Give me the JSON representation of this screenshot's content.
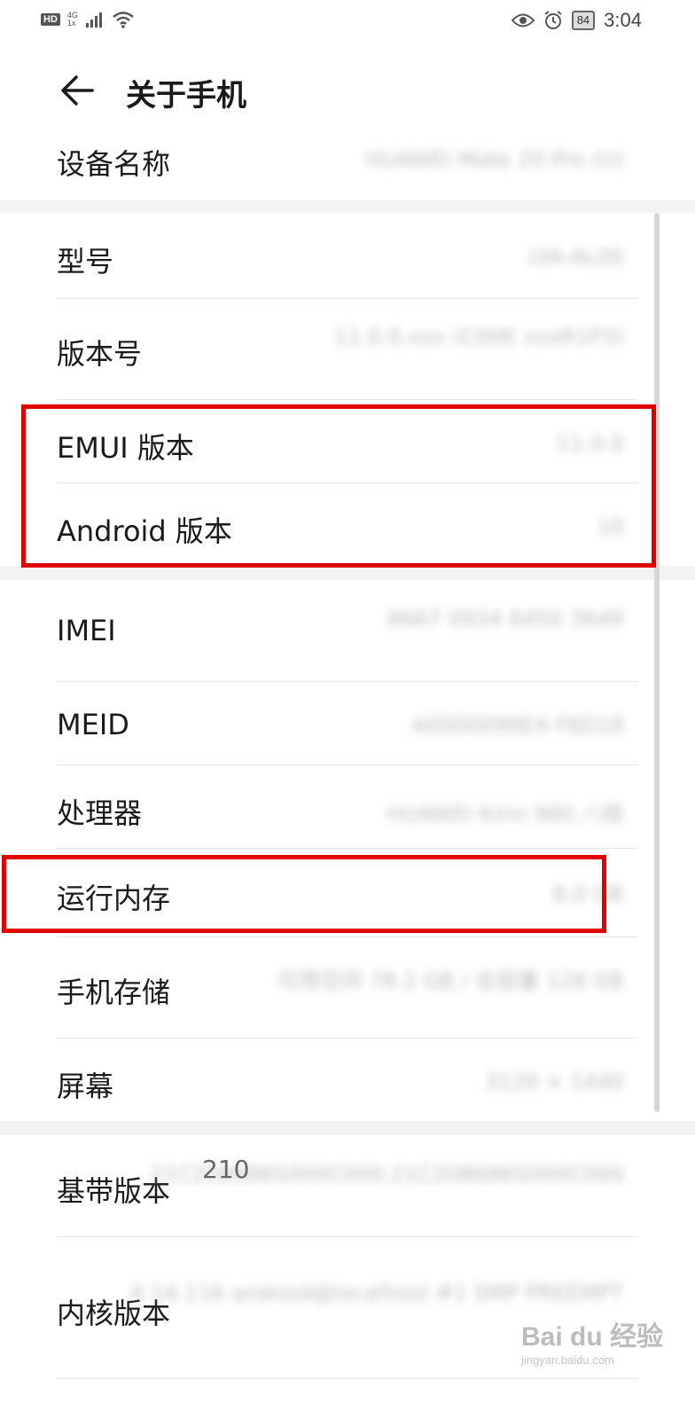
{
  "status_bar": {
    "hd": "HD",
    "network": "4G",
    "network_sub": "1x",
    "battery": "84",
    "time": "3:04"
  },
  "header": {
    "title": "关于手机"
  },
  "rows": [
    {
      "label": "设备名称",
      "value": "HUAWEI Mate 20 Pro (U)"
    },
    {
      "label": "型号",
      "value": "LYA-AL00"
    },
    {
      "label": "版本号",
      "value": "11.0.0.xxx (C00E xxxR1P3)"
    },
    {
      "label": "EMUI 版本",
      "value": "11.0.0"
    },
    {
      "label": "Android 版本",
      "value": "10"
    },
    {
      "label": "IMEI",
      "value": "8667 0934 6450 3649"
    },
    {
      "label": "MEID",
      "value": "A0000099E4 F6D18"
    },
    {
      "label": "处理器",
      "value": "HUAWEI Kirin 980 八核"
    },
    {
      "label": "运行内存",
      "value": "8.0 GB"
    },
    {
      "label": "手机存储",
      "value": "可用空间 78.2 GB / 总容量 128 GB"
    },
    {
      "label": "屏幕",
      "value": "3120 × 1440"
    },
    {
      "label": "基带版本",
      "value": "21C20B686S000C000,21C20B686S000C000"
    },
    {
      "label": "内核版本",
      "value": "4.14.116 android@localhost #1 SMP PREEMPT"
    }
  ],
  "peek_text": "210",
  "watermark": {
    "brand": "Bai du 经验",
    "url": "jingyan.baidu.com"
  },
  "colors": {
    "highlight": "#e00000",
    "background": "#f3f3f3",
    "card": "#ffffff"
  }
}
